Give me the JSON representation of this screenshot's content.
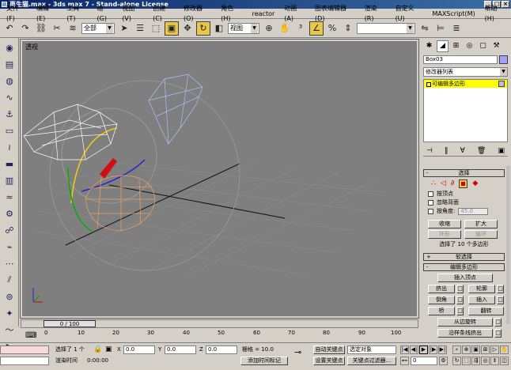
{
  "window": {
    "title": "再生猫.max - 3ds max 7 - Stand-alone License"
  },
  "menu": [
    "文件(F)",
    "编辑(E)",
    "工具(T)",
    "组(G)",
    "视图(V)",
    "创建(C)",
    "修改器(O)",
    "角色(H)",
    "reactor",
    "动画(A)",
    "图表编辑器(D)",
    "渲染(R)",
    "自定义(U)",
    "MAXScript(M)",
    "帮助(H)"
  ],
  "toolbar": {
    "selection_filter": "全部",
    "coord_system": "视图"
  },
  "viewport": {
    "label": "透视"
  },
  "panel": {
    "object_name": "Box03",
    "modifier_list": "修改器列表",
    "stack_item": "可编辑多边形",
    "selection": {
      "title": "选择",
      "by_vertex": "按顶点",
      "ignore_backface": "忽略背面",
      "by_angle": "按角度:",
      "angle_value": "45.0",
      "shrink": "收缩",
      "grow": "扩大",
      "ring": "环形",
      "loop": "循环",
      "status": "选择了 10 个多边形"
    },
    "soft_selection": {
      "title": "软选择"
    },
    "edit_polygons": {
      "title": "编辑多边形",
      "insert_vertex": "插入顶点",
      "extrude": "挤出",
      "outline": "轮廓",
      "bevel": "倒角",
      "inset": "插入",
      "bridge": "桥",
      "flip": "翻转",
      "hinge_from_edge": "从边旋转",
      "extrude_along_spline": "沿样条线挤出"
    }
  },
  "timeline": {
    "slider": "0 / 100",
    "ticks": [
      "0",
      "10",
      "20",
      "30",
      "40",
      "50",
      "60",
      "70",
      "80",
      "90",
      "100"
    ]
  },
  "status": {
    "selected": "选择了 1 个",
    "x_label": "X",
    "x_value": "0.0",
    "y_label": "Y",
    "y_value": "0.0",
    "z_label": "Z",
    "z_value": "0.0",
    "grid": "栅格 = 10.0",
    "auto_key": "自动关键点",
    "selected_object": "选定对象",
    "set_key": "设置关键点",
    "key_filters": "关键点过滤器...",
    "render_time_label": "渲染时间",
    "render_time": "0:00:00",
    "add_time_tag": "添加时间标记",
    "frame_value": "0"
  }
}
